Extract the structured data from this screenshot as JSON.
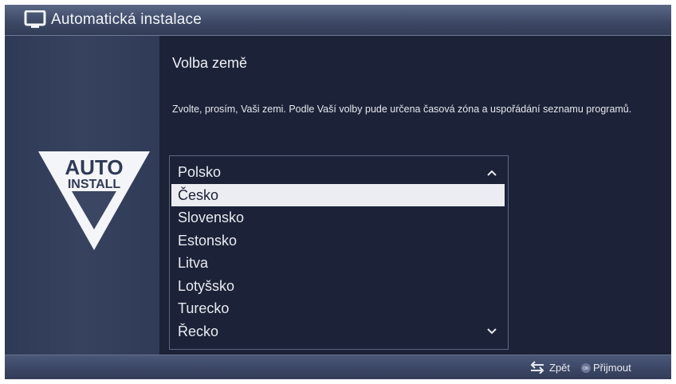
{
  "header": {
    "title": "Automatická instalace",
    "icon": "tv-icon"
  },
  "logo": {
    "line1": "AUTO",
    "line2": "INSTALL"
  },
  "main": {
    "heading": "Volba země",
    "description": "Zvolte, prosím, Vaši zemi. Podle Vaší volby pude určena časová zóna a uspořádání seznamu programů."
  },
  "country_list": {
    "items": [
      "Polsko",
      "Česko",
      "Slovensko",
      "Estonsko",
      "Litva",
      "Lotyšsko",
      "Turecko",
      "Řecko"
    ],
    "selected_index": 1
  },
  "footer": {
    "back_label": "Zpět",
    "back_icon": "back-arrows-icon",
    "ok_label": "Přijmout",
    "ok_icon_text": "OK",
    "ok_icon": "ok-button-icon"
  },
  "colors": {
    "background": "#1c2237",
    "header": "#3e4a66",
    "selection": "#ebedf2",
    "text": "#e8ebf2"
  }
}
